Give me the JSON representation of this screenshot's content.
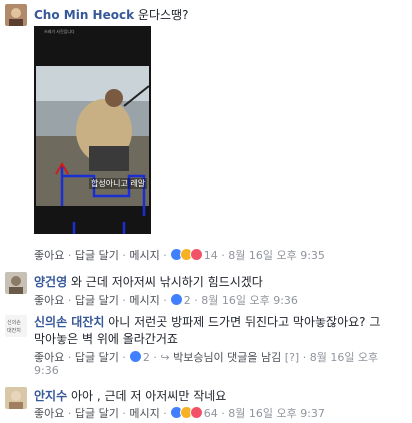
{
  "comments": [
    {
      "author": "Cho Min Heock",
      "text": "운다스땡?",
      "like": "좋아요",
      "reply": "답글 달기",
      "message": "메시지",
      "count": "14",
      "time": "8월 16일 오후 9:35"
    },
    {
      "author": "양건영",
      "text": "와 근데 저아저씨 낚시하기 힘드시겠다",
      "like": "좋아요",
      "reply": "답글 달기",
      "message": "메시지",
      "count": "2",
      "time": "8월 16일 오후 9:36"
    },
    {
      "author": "신의손 대잔치",
      "text_line1": "아니 저런곳 방파제 드가면 뒤진다고 막아놓잖아요? 그",
      "text_line2": "막아놓은 벽 위에 올라간거죠",
      "like": "좋아요",
      "reply": "답글 달기",
      "count": "2",
      "replies": "박보승님이 댓글을 남김",
      "flag": "[?]",
      "time": "8월 16일 오후",
      "time2": "9:36"
    },
    {
      "author": "안지수",
      "text": "아아 , 근데 저 아저씨만 작네요",
      "like": "좋아요",
      "reply": "답글 달기",
      "message": "메시지",
      "count": "64",
      "time": "8월 16일 오후 9:37"
    }
  ],
  "photo": {
    "caption": "합성아니고 레알",
    "header_text": "쓰레기 사진입니다"
  }
}
